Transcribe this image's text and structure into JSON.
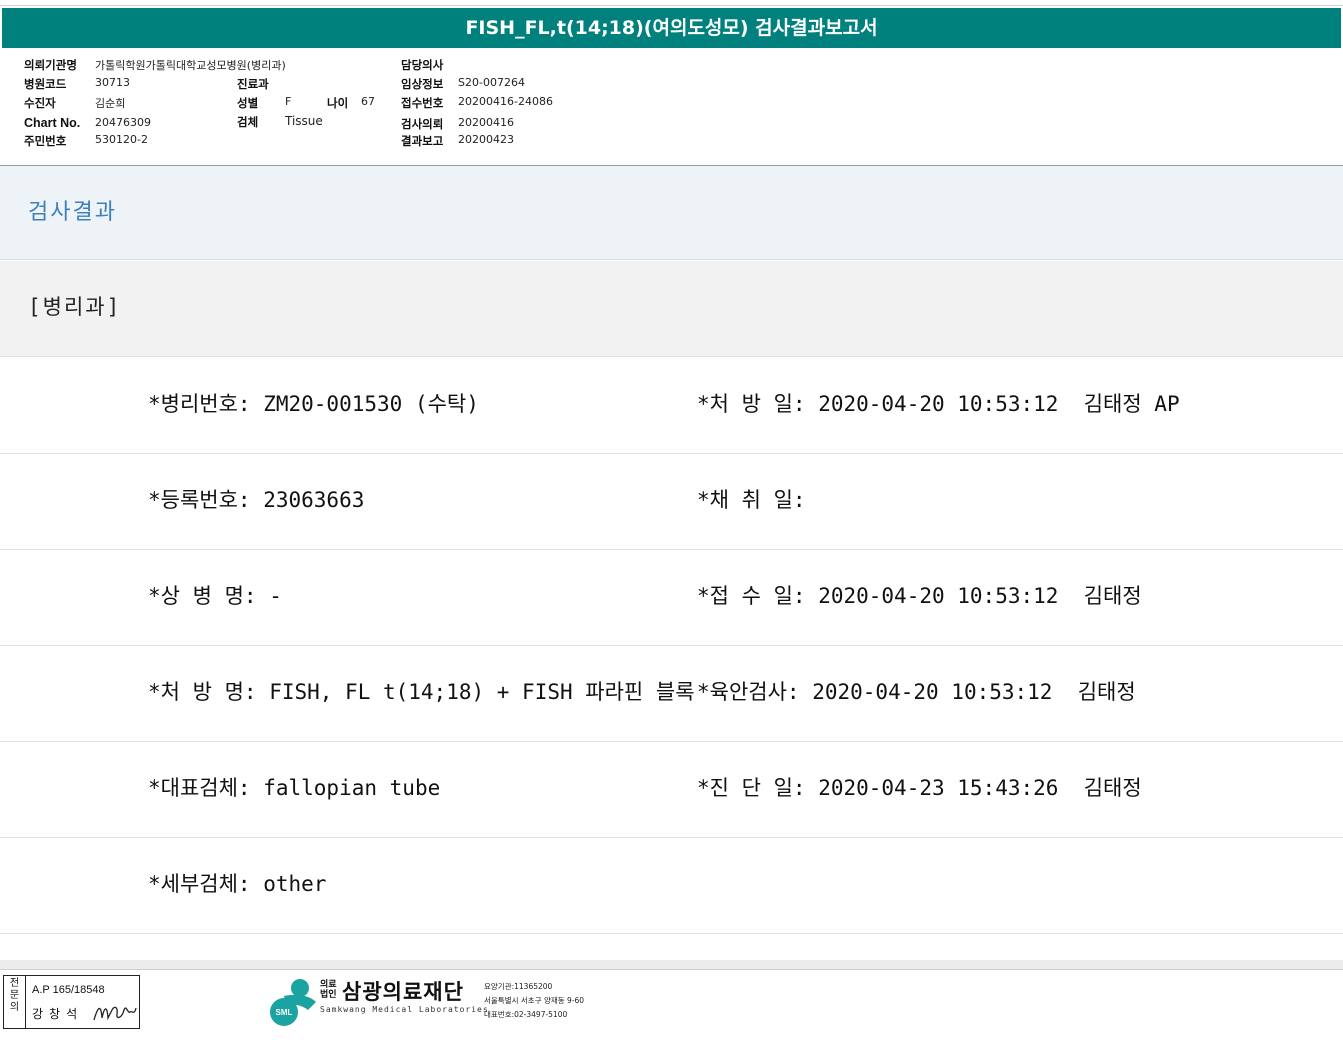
{
  "report": {
    "title": "FISH_FL,t(14;18)(여의도성모) 검사결과보고서"
  },
  "header": {
    "institution_label": "의뢰기관명",
    "institution_value": "가톨릭학원가톨릭대학교성모병원(병리과)",
    "doctor_label": "담당의사",
    "hospital_code_label": "병원코드",
    "hospital_code_value": "30713",
    "department_label": "진료과",
    "clinical_info_label": "임상정보",
    "clinical_info_value": "S20-007264",
    "patient_label": "수진자",
    "patient_value": "김순희",
    "sex_label": "성별",
    "sex_value": "F",
    "age_label": "나이",
    "age_value": "67",
    "receipt_no_label": "접수번호",
    "receipt_no_value": "20200416-24086",
    "chart_no_label": "Chart No.",
    "chart_no_value": "20476309",
    "specimen_label": "검체",
    "specimen_value": "Tissue",
    "request_label": "검사의뢰",
    "request_value": "20200416",
    "id_label": "주민번호",
    "id_value": "530120-2",
    "report_label": "결과보고",
    "report_value": "20200423"
  },
  "section": {
    "title": "검사결과",
    "department": "[병리과]"
  },
  "rows": [
    {
      "left_label": "*병리번호:",
      "left_value": " ZM20-001530 (수탁)",
      "right_label": "*처 방 일:",
      "right_value": " 2020-04-20 10:53:12  김태정 AP"
    },
    {
      "left_label": "*등록번호:",
      "left_value": " 23063663",
      "right_label": "*채 취 일:",
      "right_value": ""
    },
    {
      "left_label": "*상 병 명:",
      "left_value": " -",
      "right_label": "*접 수 일:",
      "right_value": " 2020-04-20 10:53:12  김태정"
    },
    {
      "left_label": "*처 방 명:",
      "left_value": " FISH, FL t(14;18) + FISH 파라핀 블록",
      "right_label": "*육안검사:",
      "right_value": " 2020-04-20 10:53:12  김태정"
    },
    {
      "left_label": "*대표검체:",
      "left_value": " fallopian tube",
      "right_label": "*진 단 일:",
      "right_value": " 2020-04-23 15:43:26  김태정"
    },
    {
      "left_label": "*세부검체:",
      "left_value": " other",
      "right_label": "",
      "right_value": ""
    }
  ],
  "footer": {
    "sign_side": "전문의",
    "ap_number": "A.P 165/18548",
    "physician": "강창석",
    "org_prefix_top": "의료",
    "org_prefix_bottom": "법인",
    "org_name": "삼광의료재단",
    "org_english": "Samkwang Medical Laboratories",
    "logo_text": "SML",
    "info_code": "요양기관:11365200",
    "info_address": "서울특별시 서초구 양재동 9-60",
    "info_phone": "대표번호:02-3497-5100"
  },
  "colors": {
    "title_bar": "#00817d",
    "section_title": "#3d7fbf",
    "logo": "#1aa3a0"
  }
}
